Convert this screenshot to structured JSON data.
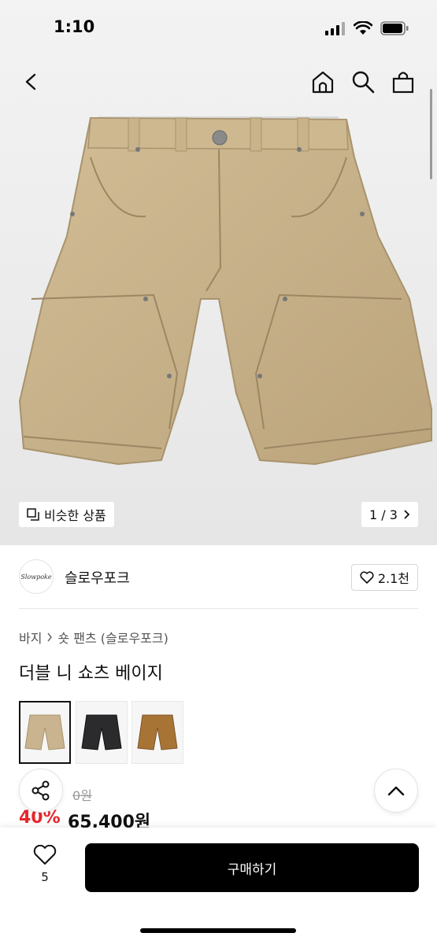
{
  "status_bar": {
    "time": "1:10"
  },
  "header": {
    "back_icon": "chevron-left-icon",
    "home_icon": "home-icon",
    "search_icon": "search-icon",
    "cart_icon": "shopping-bag-icon"
  },
  "gallery": {
    "similar_label": "비슷한 상품",
    "counter": "1 / 3"
  },
  "brand": {
    "logo_text": "Slowpoke",
    "name": "슬로우포크",
    "likes": "2.1천"
  },
  "breadcrumb": {
    "category": "바지",
    "subcategory": "숏 팬츠 (슬로우포크)"
  },
  "product": {
    "title": "더블 니 쇼츠 베이지",
    "colors": [
      "beige",
      "black",
      "brown"
    ],
    "original_price": "0원",
    "discount": "40%",
    "sale_price": "65,400원"
  },
  "bottom_bar": {
    "wish_count": "5",
    "buy_label": "구매하기"
  },
  "colors": {
    "accent_red": "#e8262e",
    "buy_button": "#000000",
    "beige_swatch": "#c9b48f",
    "black_swatch": "#2b2b2d",
    "brown_swatch": "#a87436"
  }
}
